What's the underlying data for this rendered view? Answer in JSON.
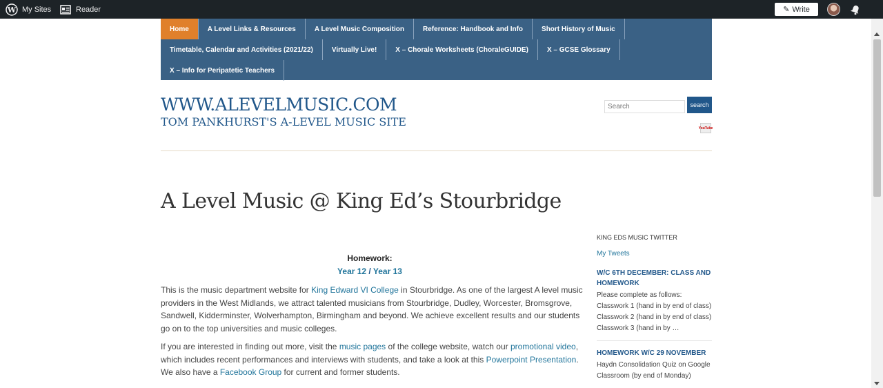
{
  "adminbar": {
    "my_sites": "My Sites",
    "reader": "Reader",
    "write": "Write"
  },
  "nav": {
    "items": [
      "Home",
      "A Level Links & Resources",
      "A Level Music Composition",
      "Reference: Handbook and Info",
      "Short History of Music",
      "Timetable, Calendar and Activities (2021/22)",
      "Virtually Live!",
      "X – Chorale Worksheets (ChoraleGUIDE)",
      "X – GCSE Glossary",
      "X – Info for Peripatetic Teachers"
    ]
  },
  "header": {
    "site_title": "WWW.ALEVELMUSIC.COM",
    "site_description": "TOM PANKHURST'S A-LEVEL MUSIC SITE",
    "search_placeholder": "Search",
    "search_button": "search",
    "youtube_label": "YouTube"
  },
  "main": {
    "page_title": "A Level Music @ King Ed’s Stourbridge",
    "homework_label": "Homework:",
    "year12": "Year 12",
    "link_sep": " / ",
    "year13": "Year 13",
    "para1": {
      "t1": "This is the music department website for ",
      "link": "King Edward VI College",
      "t2": " in Stourbridge. As one of the largest A level music providers in the West Midlands, we attract talented musicians from Stourbridge, Dudley, Worcester, Bromsgrove, Sandwell, Kidderminster, Wolverhampton, Birmingham and beyond. We achieve excellent results and our students go on to the top universities and music colleges."
    },
    "para2": {
      "t1": "If you are interested in finding out more, visit the ",
      "link1": "music pages",
      "t2": " of the college website, watch our ",
      "link2": "promotional video",
      "t3": ", which includes recent performances and interviews with students, and take a look at this ",
      "link3": "Powerpoint Presentation",
      "t4": ". We also have a ",
      "link4": "Facebook Group",
      "t5": " for current and former students."
    }
  },
  "sidebar": {
    "widget_title": "KING EDS MUSIC TWITTER",
    "tweets_link": "My Tweets",
    "post1_title": "W/C 6TH DECEMBER: CLASS AND HOMEWORK",
    "post1_lines": [
      "Please complete as follows:",
      "Classwork 1 (hand in by end of class)",
      "Classwork 2 (hand in by end of class)",
      "Classwork 3 (hand in by …"
    ],
    "post2_title": "HOMEWORK W/C 29 NOVEMBER",
    "post2_lines": [
      "Haydn Consolidation Quiz on Google",
      "Classroom (by end of Monday)"
    ]
  }
}
